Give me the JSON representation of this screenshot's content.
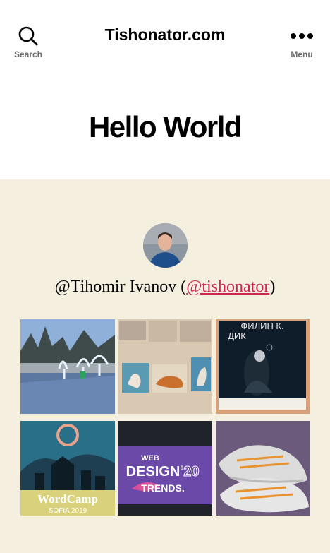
{
  "header": {
    "search_label": "Search",
    "site_title": "Tishonator.com",
    "menu_label": "Menu"
  },
  "page": {
    "title": "Hello World"
  },
  "profile": {
    "name_prefix": "@Tihomir Ivanov (",
    "handle_link": "@tishonator",
    "name_suffix": ")"
  },
  "gallery": {
    "book_text_line1": "ФИЛИП К.",
    "book_text_line2": "ДИК",
    "wordcamp_text": "WordCamp",
    "wordcamp_city": "SOFIA 2019",
    "poster_text1": "WEB",
    "poster_text2": "DESIGN",
    "poster_text3": "'20",
    "poster_text4": "TRENDS."
  },
  "colors": {
    "accent": "#cd2653",
    "background": "#f5efe0"
  }
}
